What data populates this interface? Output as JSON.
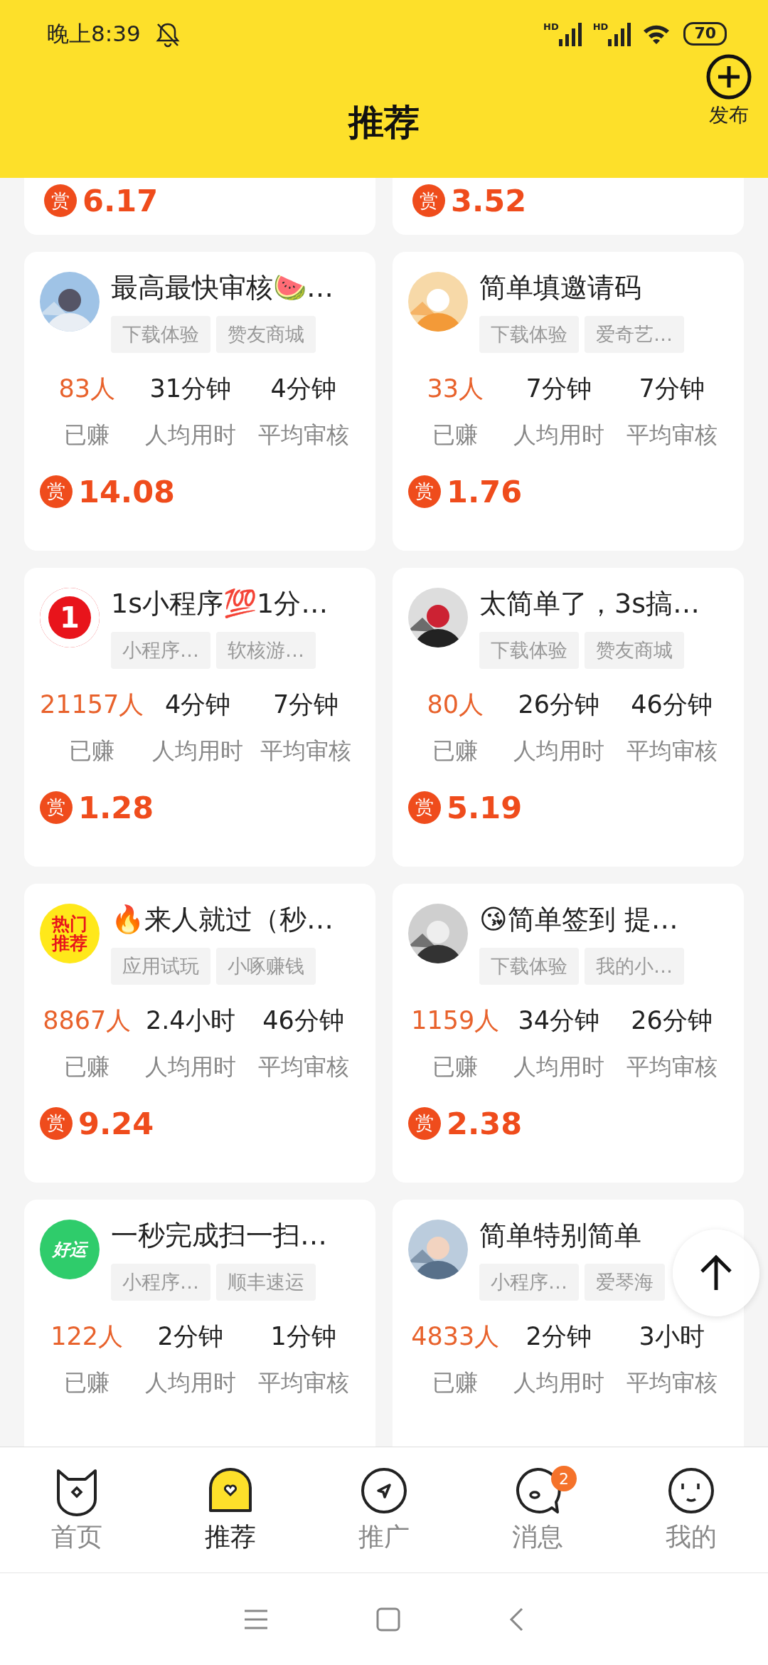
{
  "status_bar": {
    "time": "晚上8:39",
    "signal_labels": [
      "HD",
      "HD"
    ],
    "battery": "70"
  },
  "header": {
    "title": "推荐",
    "action": "发布"
  },
  "partial_cards": [
    {
      "reward_icon": "赏",
      "reward": "6.17"
    },
    {
      "reward_icon": "赏",
      "reward": "3.52"
    }
  ],
  "cards": [
    {
      "avatar": {
        "kind": "picture"
      },
      "title": "最高最快审核🍉…",
      "tags": [
        "下载体验",
        "赞友商城"
      ],
      "stats": [
        {
          "value": "83人",
          "label": "已赚"
        },
        {
          "value": "31分钟",
          "label": "人均用时"
        },
        {
          "value": "4分钟",
          "label": "平均审核"
        }
      ],
      "reward_icon": "赏",
      "reward": "14.08"
    },
    {
      "avatar": {
        "kind": "picture"
      },
      "title": "简单填邀请码",
      "tags": [
        "下载体验",
        "爱奇艺…"
      ],
      "stats": [
        {
          "value": "33人",
          "label": "已赚"
        },
        {
          "value": "7分钟",
          "label": "人均用时"
        },
        {
          "value": "7分钟",
          "label": "平均审核"
        }
      ],
      "reward_icon": "赏",
      "reward": "1.76"
    },
    {
      "avatar": {
        "kind": "number",
        "text": "1",
        "color": "#e8141b"
      },
      "title": "1s小程序💯1分…",
      "tags": [
        "小程序…",
        "软核游…"
      ],
      "stats": [
        {
          "value": "21157人",
          "label": "已赚"
        },
        {
          "value": "4分钟",
          "label": "人均用时"
        },
        {
          "value": "7分钟",
          "label": "平均审核"
        }
      ],
      "reward_icon": "赏",
      "reward": "1.28"
    },
    {
      "avatar": {
        "kind": "picture"
      },
      "title": "太简单了，3s搞…",
      "tags": [
        "下载体验",
        "赞友商城"
      ],
      "stats": [
        {
          "value": "80人",
          "label": "已赚"
        },
        {
          "value": "26分钟",
          "label": "人均用时"
        },
        {
          "value": "46分钟",
          "label": "平均审核"
        }
      ],
      "reward_icon": "赏",
      "reward": "5.19"
    },
    {
      "avatar": {
        "kind": "label",
        "text": "热门推荐",
        "color": "#ffe81a"
      },
      "title": "🔥来人就过（秒…",
      "tags": [
        "应用试玩",
        "小啄赚钱"
      ],
      "stats": [
        {
          "value": "8867人",
          "label": "已赚"
        },
        {
          "value": "2.4小时",
          "label": "人均用时"
        },
        {
          "value": "46分钟",
          "label": "平均审核"
        }
      ],
      "reward_icon": "赏",
      "reward": "9.24"
    },
    {
      "avatar": {
        "kind": "picture"
      },
      "title": "😘简单签到 提…",
      "tags": [
        "下载体验",
        "我的小…"
      ],
      "stats": [
        {
          "value": "1159人",
          "label": "已赚"
        },
        {
          "value": "34分钟",
          "label": "人均用时"
        },
        {
          "value": "26分钟",
          "label": "平均审核"
        }
      ],
      "reward_icon": "赏",
      "reward": "2.38"
    },
    {
      "avatar": {
        "kind": "label",
        "text": "好运",
        "color": "#2fcc6b"
      },
      "title": "一秒完成扫一扫…",
      "tags": [
        "小程序…",
        "顺丰速运"
      ],
      "stats": [
        {
          "value": "122人",
          "label": "已赚"
        },
        {
          "value": "2分钟",
          "label": "人均用时"
        },
        {
          "value": "1分钟",
          "label": "平均审核"
        }
      ]
    },
    {
      "avatar": {
        "kind": "picture"
      },
      "title": "简单特别简单",
      "tags": [
        "小程序…",
        "爱琴海"
      ],
      "stats": [
        {
          "value": "4833人",
          "label": "已赚"
        },
        {
          "value": "2分钟",
          "label": "人均用时"
        },
        {
          "value": "3小时",
          "label": "平均审核"
        }
      ]
    }
  ],
  "nav": [
    {
      "label": "首页",
      "selected": false
    },
    {
      "label": "推荐",
      "selected": true
    },
    {
      "label": "推广",
      "selected": false
    },
    {
      "label": "消息",
      "selected": false,
      "badge": "2"
    },
    {
      "label": "我的",
      "selected": false
    }
  ]
}
